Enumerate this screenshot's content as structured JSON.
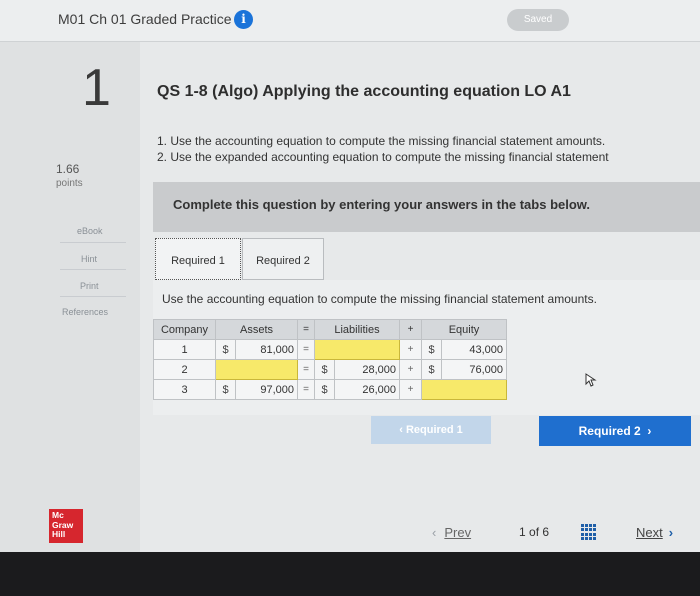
{
  "header": {
    "assignment_title": "M01 Ch 01 Graded Practice",
    "info_glyph": "i",
    "saved_label": "Saved"
  },
  "sidebar": {
    "question_number": "1",
    "points_value": "1.66",
    "points_label": "points",
    "links": [
      "eBook",
      "Hint",
      "Print",
      "References"
    ]
  },
  "question": {
    "title": "QS 1-8 (Algo) Applying the accounting equation LO A1",
    "instructions": [
      "1. Use the accounting equation to compute the missing financial statement amounts.",
      "2. Use the expanded accounting equation to compute the missing financial statement"
    ],
    "banner": "Complete this question by entering your answers in the tabs below."
  },
  "tabs": [
    {
      "label": "Required 1",
      "active": true
    },
    {
      "label": "Required 2",
      "active": false
    }
  ],
  "content": {
    "instruction": "Use the accounting equation to compute the missing financial statement amounts.",
    "table": {
      "headers": [
        "Company",
        "Assets",
        "=",
        "Liabilities",
        "+",
        "Equity"
      ],
      "rows": [
        {
          "company": "1",
          "assets_cur": "$",
          "assets": "81,000",
          "eq": "=",
          "liab_cur": "",
          "liab": "",
          "plus": "+",
          "equity_cur": "$",
          "equity": "43,000"
        },
        {
          "company": "2",
          "assets_cur": "",
          "assets": "",
          "eq": "=",
          "liab_cur": "$",
          "liab": "28,000",
          "plus": "+",
          "equity_cur": "$",
          "equity": "76,000"
        },
        {
          "company": "3",
          "assets_cur": "$",
          "assets": "97,000",
          "eq": "=",
          "liab_cur": "$",
          "liab": "26,000",
          "plus": "+",
          "equity_cur": "",
          "equity": ""
        }
      ]
    },
    "prev_req_label": "Required 1",
    "next_req_label": "Required 2"
  },
  "footer": {
    "logo": [
      "Mc",
      "Graw",
      "Hill"
    ],
    "prev_label": "Prev",
    "page_current": "1",
    "page_of": "of",
    "page_total": "6",
    "next_label": "Next"
  },
  "colors": {
    "accent_blue": "#1f6fcf",
    "input_yellow": "#f7e96a",
    "logo_red": "#d6262e"
  },
  "icons": [
    "info-icon",
    "grid-icon",
    "chevron-left-icon",
    "chevron-right-icon",
    "cursor-icon"
  ]
}
